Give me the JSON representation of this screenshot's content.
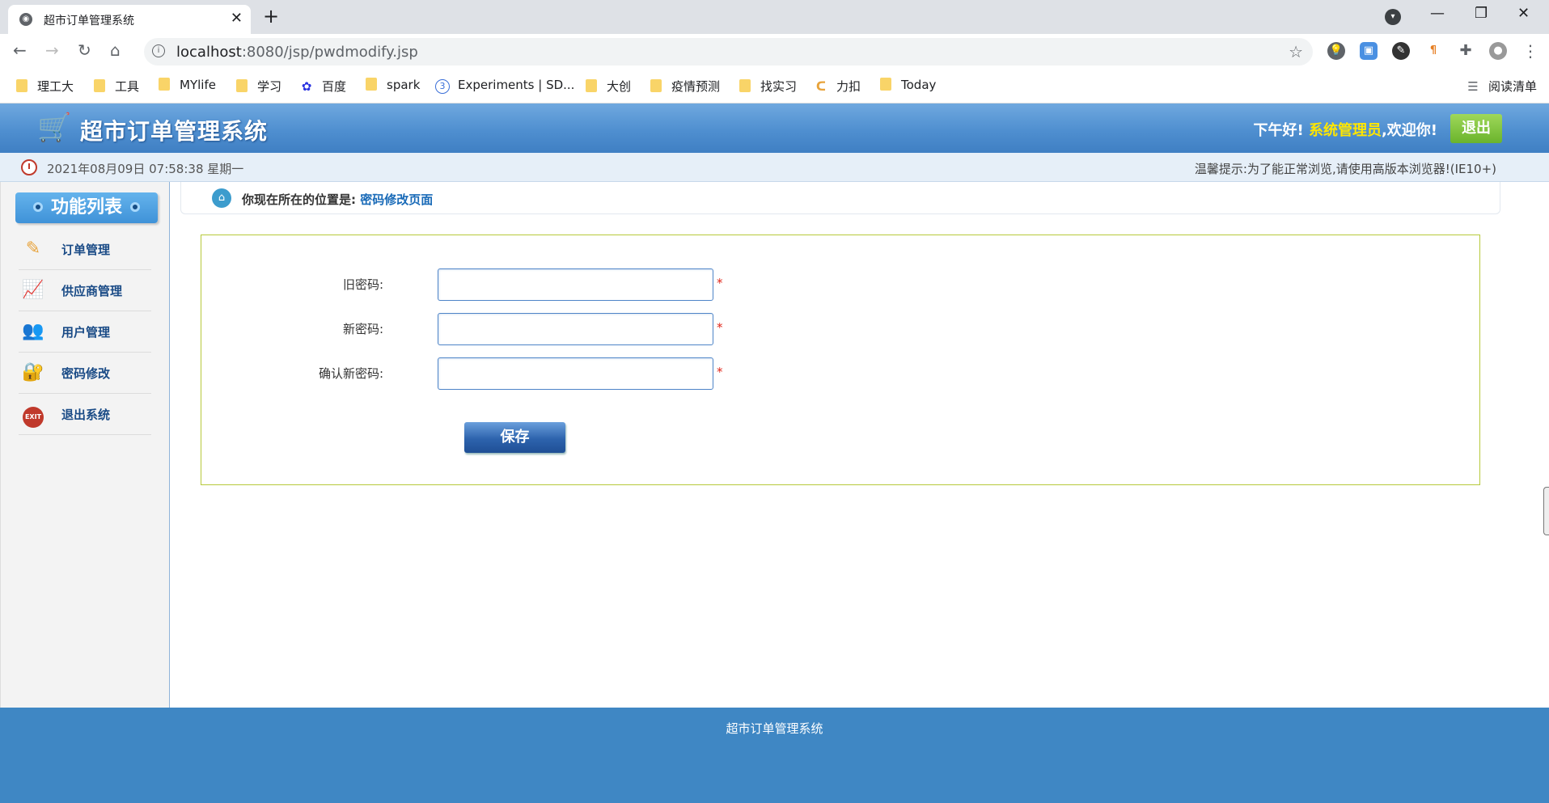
{
  "browser": {
    "tab_title": "超市订单管理系统",
    "url_host": "localhost",
    "url_path": ":8080/jsp/pwdmodify.jsp",
    "bookmarks": [
      "理工大",
      "工具",
      "MYlife",
      "学习",
      "百度",
      "spark",
      "Experiments | SD...",
      "大创",
      "疫情预测",
      "找实习",
      "力扣",
      "Today"
    ],
    "reading_list": "阅读清单"
  },
  "header": {
    "title": "超市订单管理系统",
    "greeting": "下午好!",
    "username": "系统管理员",
    "welcome": ",欢迎你!",
    "logout": "退出"
  },
  "infobar": {
    "datetime": "2021年08月09日 07:58:38 星期一",
    "tip": "温馨提示:为了能正常浏览,请使用高版本浏览器!(IE10+)"
  },
  "sidebar": {
    "title": "功能列表",
    "items": [
      {
        "label": "订单管理",
        "icon": "order-icon"
      },
      {
        "label": "供应商管理",
        "icon": "supplier-icon"
      },
      {
        "label": "用户管理",
        "icon": "users-icon"
      },
      {
        "label": "密码修改",
        "icon": "password-icon"
      },
      {
        "label": "退出系统",
        "icon": "exit-icon"
      }
    ]
  },
  "breadcrumb": {
    "label": "你现在所在的位置是:",
    "page": "密码修改页面"
  },
  "form": {
    "old_password_label": "旧密码:",
    "new_password_label": "新密码:",
    "confirm_password_label": "确认新密码:",
    "required_mark": "*",
    "old_password_value": "",
    "new_password_value": "",
    "confirm_password_value": "",
    "save": "保存"
  },
  "footer": {
    "text": "超市订单管理系统"
  }
}
